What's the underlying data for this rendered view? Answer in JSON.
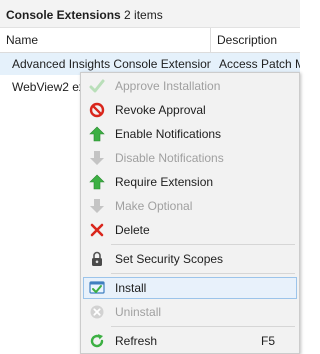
{
  "panel": {
    "title": "Console Extensions",
    "count": "2 items"
  },
  "columns": {
    "name": "Name",
    "description": "Description"
  },
  "rows": [
    {
      "name": "Advanced Insights Console Extension",
      "description": "Access Patch M"
    },
    {
      "name": "WebView2 ex",
      "description": ""
    }
  ],
  "context_menu": {
    "items": [
      {
        "label": "Approve Installation",
        "icon": "green-check-icon",
        "disabled": true
      },
      {
        "label": "Revoke Approval",
        "icon": "red-no-entry-icon",
        "disabled": false
      },
      {
        "label": "Enable Notifications",
        "icon": "green-up-arrow-icon",
        "disabled": false
      },
      {
        "label": "Disable Notifications",
        "icon": "gray-down-arrow-icon",
        "disabled": true
      },
      {
        "label": "Require Extension",
        "icon": "green-up-arrow-icon",
        "disabled": false
      },
      {
        "label": "Make Optional",
        "icon": "gray-down-arrow-icon",
        "disabled": true
      },
      {
        "label": "Delete",
        "icon": "red-x-icon",
        "disabled": false
      },
      {
        "label": "Set Security Scopes",
        "icon": "padlock-icon",
        "disabled": false
      },
      {
        "label": "Install",
        "icon": "install-icon",
        "disabled": false,
        "highlighted": true
      },
      {
        "label": "Uninstall",
        "icon": "gray-x-circle-icon",
        "disabled": true
      },
      {
        "label": "Refresh",
        "icon": "refresh-icon",
        "disabled": false,
        "shortcut": "F5"
      }
    ]
  },
  "colors": {
    "accent_green": "#3cb043",
    "danger_red": "#d9261c",
    "disabled_gray": "#a0a0a0",
    "highlight_bg": "#e8f1fb",
    "highlight_border": "#9cc4ea"
  }
}
